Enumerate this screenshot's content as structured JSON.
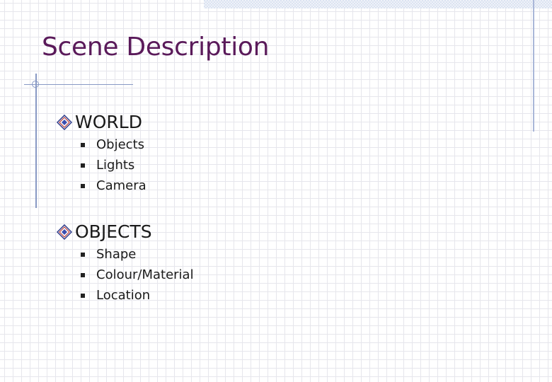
{
  "slide": {
    "title": "Scene Description",
    "sections": [
      {
        "heading": "WORLD",
        "items": [
          "Objects",
          "Lights",
          "Camera"
        ]
      },
      {
        "heading": "OBJECTS",
        "items": [
          "Shape",
          "Colour/Material",
          "Location"
        ]
      }
    ]
  },
  "colors": {
    "title": "#5a1a5a",
    "accent_lines": "#8899c4",
    "grid": "#e6e6ec"
  },
  "icons": {
    "level1_bullet": "diamond-bullet-icon",
    "level2_bullet": "square-bullet-icon"
  }
}
